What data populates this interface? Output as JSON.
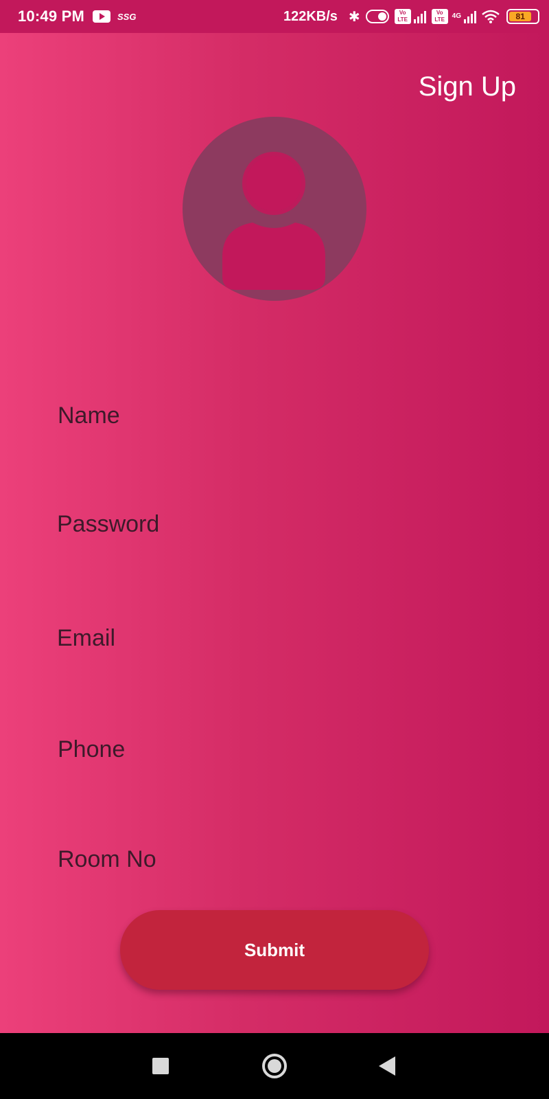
{
  "status_bar": {
    "time": "10:49 PM",
    "notification_label": "SSG",
    "network_speed": "122KB/s",
    "volte_label_top": "Vo",
    "volte_label_bottom": "LTE",
    "network_type": "4G",
    "battery_level": "81",
    "icons": [
      "youtube-icon",
      "bluetooth-icon",
      "toggle-icon",
      "volte-icon",
      "signal-icon",
      "wifi-icon",
      "battery-icon"
    ]
  },
  "page": {
    "title": "Sign Up"
  },
  "avatar": {
    "icon": "user-avatar-icon",
    "background_color": "#8d3a5f"
  },
  "form": {
    "fields": [
      {
        "label": "Name"
      },
      {
        "label": "Password"
      },
      {
        "label": "Email"
      },
      {
        "label": "Phone"
      },
      {
        "label": "Room No"
      }
    ],
    "submit_label": "Submit"
  },
  "nav_bar": {
    "icons": [
      "recents-icon",
      "home-icon",
      "back-icon"
    ]
  },
  "colors": {
    "gradient_start": "#ec407a",
    "gradient_end": "#c2185b",
    "button": "#c2243d",
    "label_text": "#3d1a2a"
  }
}
